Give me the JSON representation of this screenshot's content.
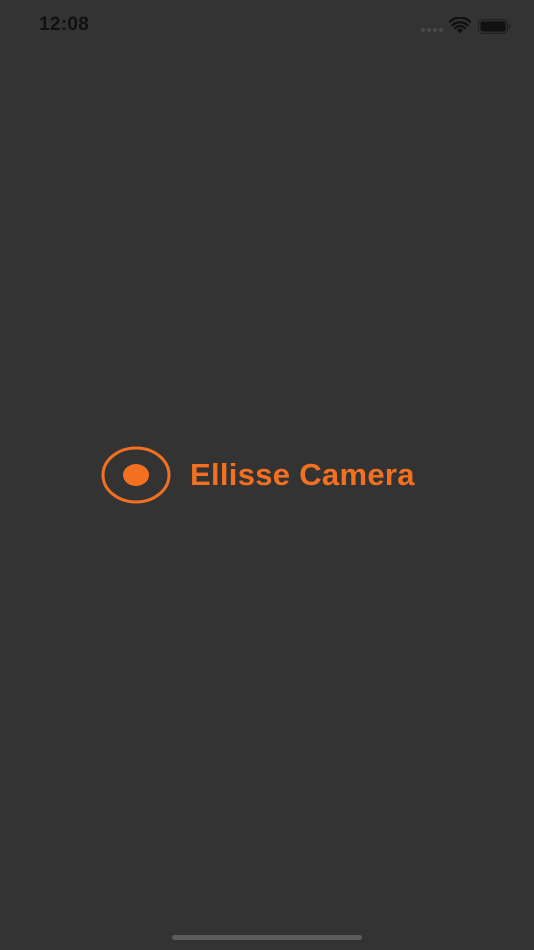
{
  "status_bar": {
    "time": "12:08",
    "icons": [
      "cellular-signal-icon",
      "wifi-icon",
      "battery-icon"
    ]
  },
  "splash": {
    "logo_icon": "record-ring-icon",
    "app_name": "Ellisse Camera"
  },
  "colors": {
    "background": "#333333",
    "accent": "#f37021",
    "status_text": "#111111"
  }
}
